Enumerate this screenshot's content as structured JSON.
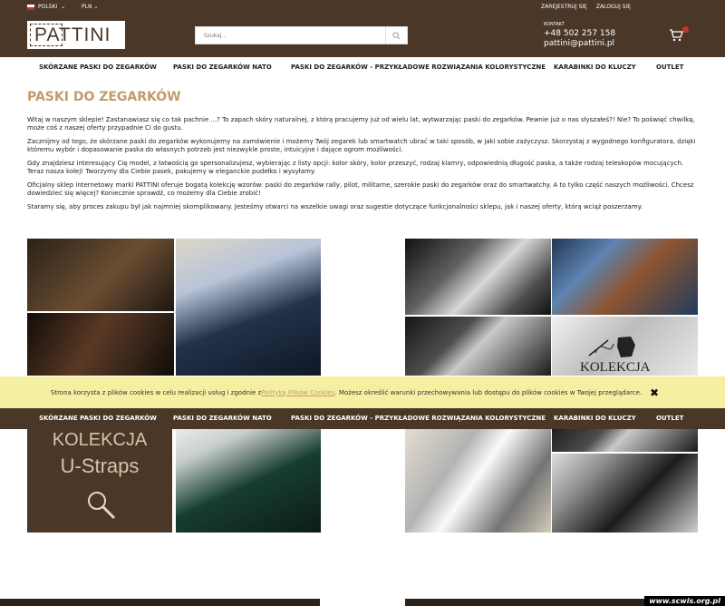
{
  "topbar": {
    "language": "POLSKI",
    "currency": "PLN",
    "register": "ZAREJESTRUJ SIĘ",
    "login": "ZALOGUJ SIĘ"
  },
  "header": {
    "logo": "PATTINI",
    "search_placeholder": "Szukaj...",
    "contact_label": "KONTAKT",
    "phone": "+48 502 257 158",
    "email": "pattini@pattini.pl",
    "cart_count": "1"
  },
  "nav": {
    "items": [
      "SKÓRZANE PASKI DO ZEGARKÓW",
      "PASKI DO ZEGARKÓW NATO",
      "PASKI DO ZEGARKÓW - PRZYKŁADOWE ROZWIĄZANIA KOLORYSTYCZNE",
      "KARABINKI DO KLUCZY",
      "OUTLET"
    ]
  },
  "main": {
    "title": "PASKI DO ZEGARKÓW",
    "paragraphs": [
      "Witaj w naszym sklepie! Zastanawiasz się co tak pachnie ...? To zapach skóry naturalnej, z którą pracujemy już od wielu lat, wytwarzając paski do zegarków. Pewnie już o nas słyszałeś?! Nie? To poświęć chwilkę, może coś z naszej oferty przypadnie Ci do gustu.",
      "Zacznijmy od tego, że skórzane paski do zegarków wykonujemy na zamówienie i możemy Twój zegarek lub smartwatch ubrać w taki sposób, w jaki sobie zażyczysz. Skorzystaj z wygodnego konfiguratora, dzięki któremu wybór i dopasowanie paska do własnych potrzeb jest niezwykle proste, intuicyjne i dające ogrom możliwości.",
      "Gdy znajdziesz interesujący Cię model, z łatwością go spersonalizujesz, wybierając z listy opcji: kolor skóry, kolor przeszyć, rodzaj klamry, odpowiednią długość paska, a także rodzaj teleskopów mocujących. Teraz nasza kolej! Tworzymy dla Ciebie pasek, pakujemy w eleganckie pudełko i wysyłamy.",
      "Oficjalny sklep internetowy marki PATTINI oferuje bogatą kolekcję wzorów: paski do zegarków rally, pilot, militarne, szerokie paski do zegarków oraz do smartwatchy. A to tylko część naszych możliwości. Chcesz dowiedzieć się więcej? Koniecznie sprawdź, co możemy dla Ciebie zrobić!",
      "Staramy się, aby proces zakupu był jak najmniej skomplikowany. Jesteśmy otwarci na wszelkie uwagi oraz sugestie dotyczące funkcjonalności sklepu, jak i naszej oferty, którą wciąż poszerzamy."
    ]
  },
  "gallery": {
    "kolekcja_line1": "KOLEKCJA",
    "kolekcja_line2": "U-Straps",
    "kolekcja_right": "KOLEKCJA"
  },
  "cookie": {
    "text_before": "Strona korzysta z plików cookies w celu realizacji usług i zgodnie z ",
    "link": "Polityką Plików Cookies",
    "text_after": ". Możesz określić warunki przechowywania lub dostępu do plików cookies w Twojej przeglądarce.",
    "close": "✖"
  },
  "watermark": "www.scwis.org.pl",
  "colors": {
    "brand_brown": "#4a3728",
    "accent_gold": "#c39a6b",
    "cookie_bg": "#f5f0a1"
  }
}
